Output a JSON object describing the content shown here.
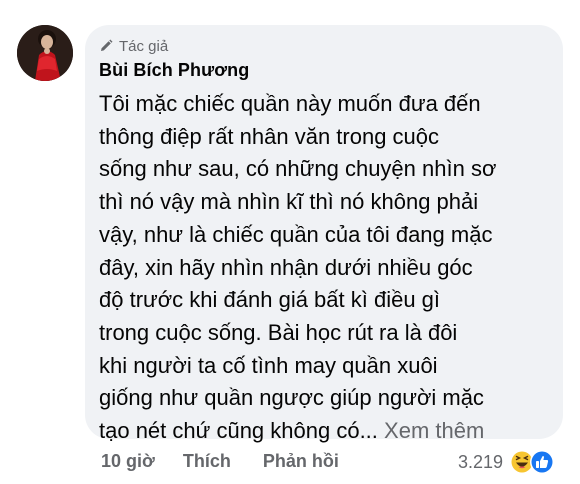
{
  "comment": {
    "badge_label": "Tác giả",
    "author": "Bùi Bích Phương",
    "text_lines": [
      "Tôi mặc chiếc quần này muốn đưa đến",
      "thông điệp rất nhân văn trong cuộc",
      "sống như sau, có những chuyện nhìn sơ",
      "thì nó vậy mà nhìn kĩ thì nó không phải",
      "vậy, như là chiếc quần của tôi đang mặc",
      "đây, xin hãy nhìn nhận dưới nhiều góc",
      "độ trước khi đánh giá bất kì điều gì",
      "trong cuộc sống. Bài học rút ra là đôi",
      "khi người ta cố tình may quần xuôi",
      "giống như quần ngược giúp người mặc",
      "tạo nét chứ cũng không có..."
    ],
    "see_more": "Xem thêm",
    "see_more_color": "#65676b",
    "bubble_color": "#f0f2f5"
  },
  "actions": {
    "time": "10 giờ",
    "like": "Thích",
    "reply": "Phản hồi"
  },
  "reactions": {
    "count": "3.219",
    "icons": [
      "laughing-emoji-icon",
      "like-thumb-icon"
    ]
  }
}
